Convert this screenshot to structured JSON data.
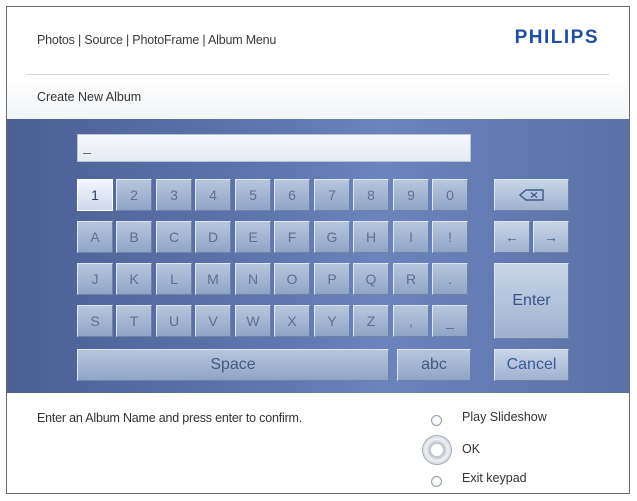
{
  "header": {
    "breadcrumb": "Photos | Source | PhotoFrame | Album Menu",
    "brand": "PHILIPS"
  },
  "page": {
    "title": "Create New Album"
  },
  "input": {
    "value": "_"
  },
  "keyboard": {
    "selected": "1",
    "rows": [
      [
        "1",
        "2",
        "3",
        "4",
        "5",
        "6",
        "7",
        "8",
        "9",
        "0"
      ],
      [
        "A",
        "B",
        "C",
        "D",
        "E",
        "F",
        "G",
        "H",
        "I",
        "!"
      ],
      [
        "J",
        "K",
        "L",
        "M",
        "N",
        "O",
        "P",
        "Q",
        "R",
        "."
      ],
      [
        "S",
        "T",
        "U",
        "V",
        "W",
        "X",
        "Y",
        "Z",
        ",",
        "_"
      ]
    ],
    "space": "Space",
    "abc": "abc",
    "enter": "Enter",
    "cancel": "Cancel",
    "left_arrow": "←",
    "right_arrow": "→"
  },
  "footer": {
    "instruction": "Enter an Album Name and press enter to confirm.",
    "legend": [
      "Play Slideshow",
      "OK",
      "Exit keypad"
    ]
  },
  "colors": {
    "brand": "#1f4fa0",
    "panel": "#5a71a6",
    "key": "#a3b6d4"
  }
}
